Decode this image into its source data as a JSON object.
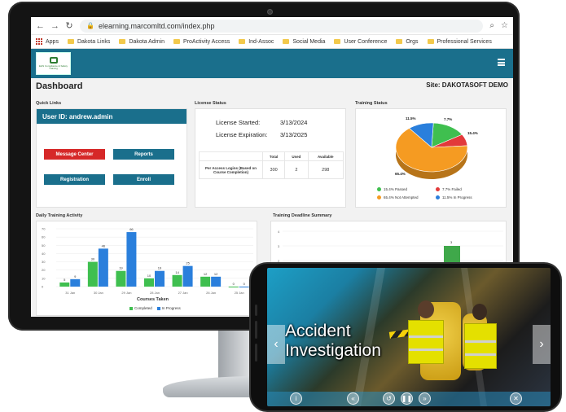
{
  "browser": {
    "url": "elearning.marcomltd.com/index.php",
    "bookmarks": [
      "Apps",
      "Dakota Links",
      "Dakota Admin",
      "ProActivity Access",
      "Ind-Assoc",
      "Social Media",
      "User Conference",
      "Orgs",
      "Professional Services"
    ]
  },
  "header": {
    "logo_text": "EHS Compliance & Safety Training"
  },
  "dashboard": {
    "title": "Dashboard",
    "site": "Site: DAKOTASOFT DEMO"
  },
  "quick_links": {
    "label": "Quick Links",
    "user_id": "User ID:  andrew.admin",
    "buttons": [
      "Message Center",
      "Reports",
      "Registration",
      "Enroll"
    ]
  },
  "license": {
    "label": "License Status",
    "started_label": "License Started:",
    "started_value": "3/13/2024",
    "expiration_label": "License Expiration:",
    "expiration_value": "3/13/2025",
    "table": {
      "headers": [
        "",
        "Total",
        "Used",
        "Available"
      ],
      "row": [
        "Per Access Logins (Based on Course Completion)",
        "300",
        "2",
        "298"
      ]
    }
  },
  "training_status": {
    "label": "Training Status",
    "pie_labels": [
      "11.5%",
      "7.7%",
      "15.4%",
      "65.4%"
    ],
    "legend": [
      "15.4% Passed",
      "7.7% Failed",
      "65.4% Not Attempted",
      "11.5% In Progress"
    ]
  },
  "daily_activity": {
    "label": "Daily Training Activity",
    "xlabel": "Courses Taken",
    "legend": [
      "Completed",
      "In Progress"
    ]
  },
  "deadline": {
    "label": "Training Deadline Summary",
    "yticks": [
      "4",
      "3",
      "2"
    ],
    "bar_value": "3"
  },
  "video": {
    "title_line1": "Accident",
    "title_line2": "Investigation"
  },
  "colors": {
    "brand": "#1a6f8c",
    "completed": "#3fbf4f",
    "in_progress": "#2a7fdc",
    "passed": "#3fbf4f",
    "failed": "#e23a3a",
    "not_attempted": "#f59b22",
    "progress_pie": "#2a7fdc"
  },
  "chart_data": [
    {
      "type": "bar",
      "title": "Daily Training Activity",
      "xlabel": "Courses Taken",
      "categories": [
        "31 Jan",
        "30 Jan",
        "29 Jan",
        "28 Jan",
        "27 Jan",
        "26 Jan",
        "25 Jan"
      ],
      "series": [
        {
          "name": "Completed",
          "values": [
            5,
            30,
            19,
            10,
            14,
            12,
            0
          ]
        },
        {
          "name": "In Progress",
          "values": [
            9,
            46,
            66,
            19,
            25,
            12,
            0
          ]
        }
      ],
      "ylim": [
        0,
        70
      ],
      "yticks": [
        0,
        10,
        20,
        30,
        40,
        50,
        60,
        70
      ],
      "legend": "bottom"
    },
    {
      "type": "pie",
      "title": "Training Status",
      "labels": [
        "Passed",
        "Failed",
        "Not Attempted",
        "In Progress"
      ],
      "values": [
        15.4,
        7.7,
        65.4,
        11.5
      ]
    }
  ]
}
